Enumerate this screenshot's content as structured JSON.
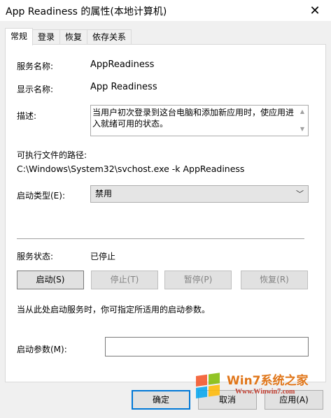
{
  "window": {
    "title": "App Readiness 的属性(本地计算机)",
    "close_label": "✕"
  },
  "tabs": [
    {
      "label": "常规"
    },
    {
      "label": "登录"
    },
    {
      "label": "恢复"
    },
    {
      "label": "依存关系"
    }
  ],
  "general": {
    "service_name_label": "服务名称:",
    "service_name_value": "AppReadiness",
    "display_name_label": "显示名称:",
    "display_name_value": "App Readiness",
    "description_label": "描述:",
    "description_value": "当用户初次登录到这台电脑和添加新应用时，使应用进入就绪可用的状态。",
    "exe_path_label": "可执行文件的路径:",
    "exe_path_value": "C:\\Windows\\System32\\svchost.exe -k AppReadiness",
    "startup_type_label": "启动类型(E):",
    "startup_type_value": "禁用",
    "service_status_label": "服务状态:",
    "service_status_value": "已停止",
    "start_button": "启动(S)",
    "stop_button": "停止(T)",
    "pause_button": "暂停(P)",
    "resume_button": "恢复(R)",
    "hint_text": "当从此处启动服务时，你可指定所适用的启动参数。",
    "start_params_label": "启动参数(M):",
    "start_params_value": ""
  },
  "footer": {
    "ok_button": "确定",
    "cancel_button": "取消",
    "apply_button": "应用(A)"
  },
  "watermark": {
    "brand_text": "Win7系统之家",
    "url_text": "Www.Winwin7.com"
  }
}
